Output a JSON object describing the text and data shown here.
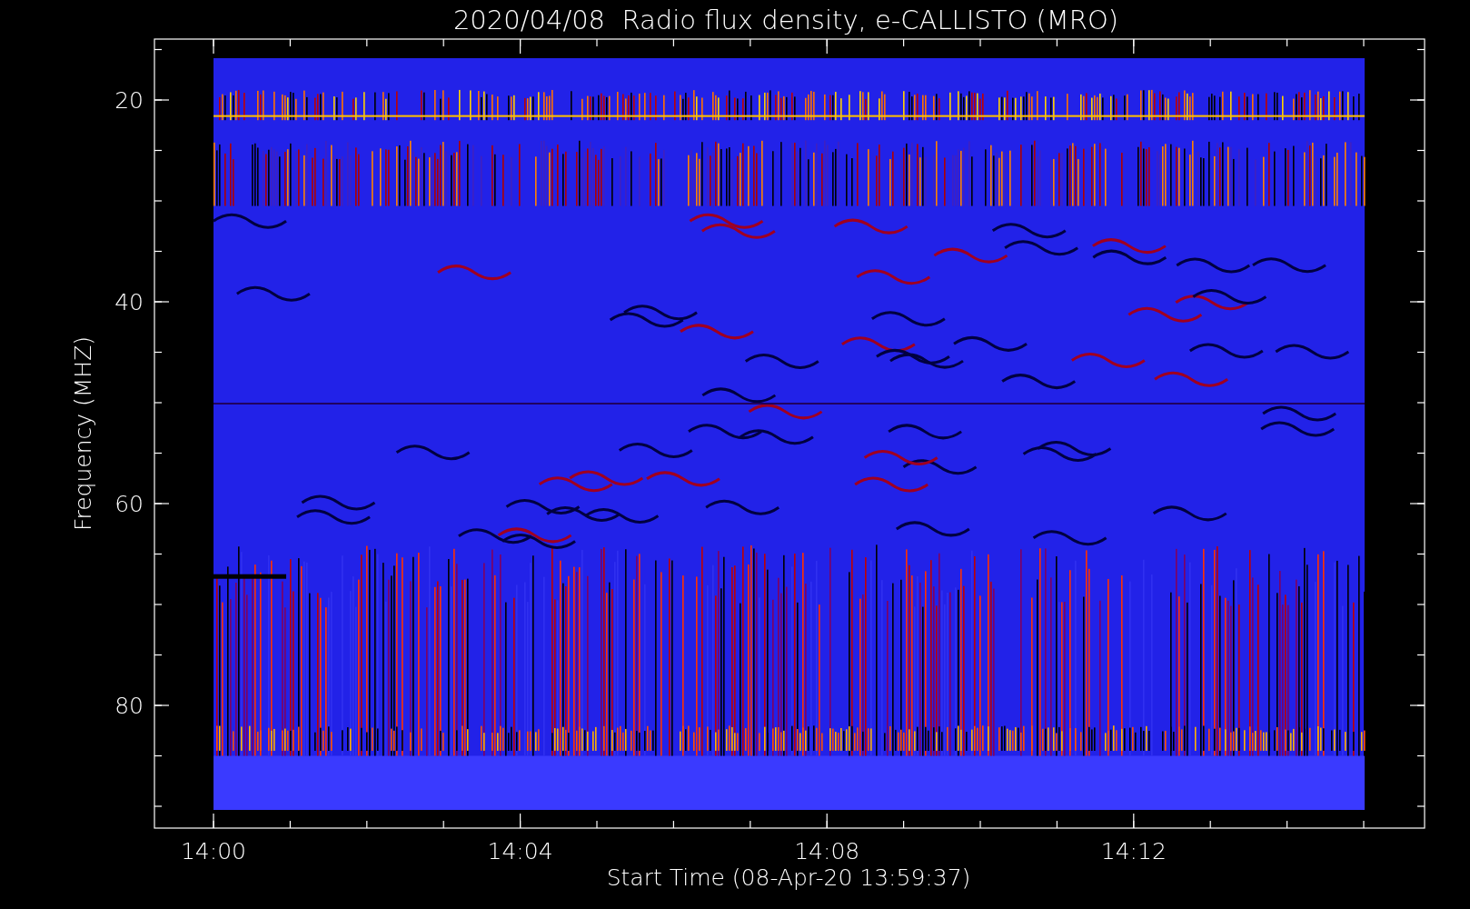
{
  "title": "2020/04/08  Radio flux density, e-CALLISTO (MRO)",
  "y_axis": {
    "label": "Frequency (MHZ)",
    "ticks": [
      "20",
      "40",
      "60",
      "80"
    ]
  },
  "x_axis": {
    "label": "Start Time (08-Apr-20 13:59:37)",
    "ticks": [
      "14:00",
      "14:04",
      "14:08",
      "14:12"
    ]
  }
}
